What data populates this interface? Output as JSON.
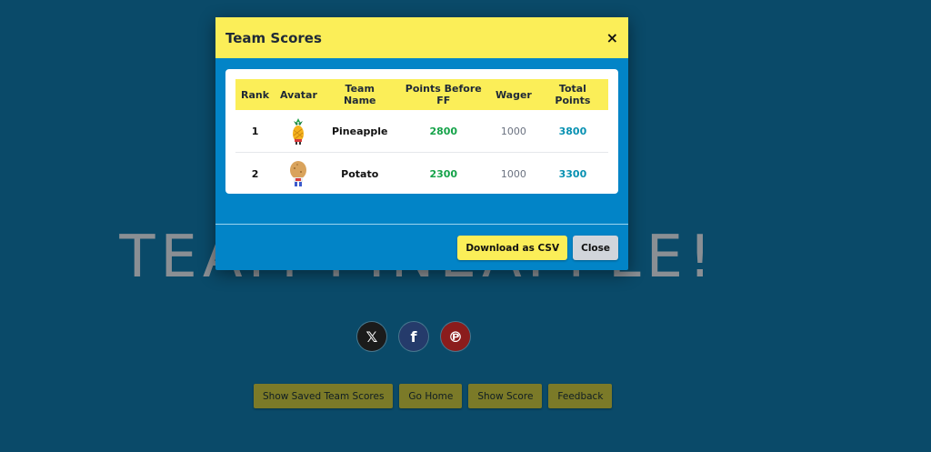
{
  "background": {
    "title": "TEAM PINEAPPLE!",
    "share": {
      "x_icon": "x-logo-icon",
      "x_glyph": "𝕏",
      "facebook_icon": "facebook-icon",
      "facebook_glyph": "f",
      "pinterest_icon": "pinterest-icon",
      "pinterest_glyph": "℗"
    },
    "buttons": {
      "saved_scores": "Show Saved Team Scores",
      "go_home": "Go Home",
      "show_score": "Show Score",
      "feedback": "Feedback"
    }
  },
  "modal": {
    "title": "Team Scores",
    "close_glyph": "×",
    "columns": {
      "rank": "Rank",
      "avatar": "Avatar",
      "team_name": "Team Name",
      "points_before": "Points Before FF",
      "wager": "Wager",
      "total": "Total Points"
    },
    "rows": [
      {
        "rank": "1",
        "avatar": "pineapple-avatar",
        "team": "Pineapple",
        "points_before": "2800",
        "wager": "1000",
        "total": "3800"
      },
      {
        "rank": "2",
        "avatar": "potato-avatar",
        "team": "Potato",
        "points_before": "2300",
        "wager": "1000",
        "total": "3300"
      }
    ],
    "footer": {
      "download_csv": "Download as CSV",
      "close": "Close"
    }
  },
  "colors": {
    "page_bg": "#0a4a69",
    "modal_bg": "#0284c7",
    "accent_yellow": "#fbee58",
    "green": "#16a34a",
    "teal": "#0891b2"
  }
}
